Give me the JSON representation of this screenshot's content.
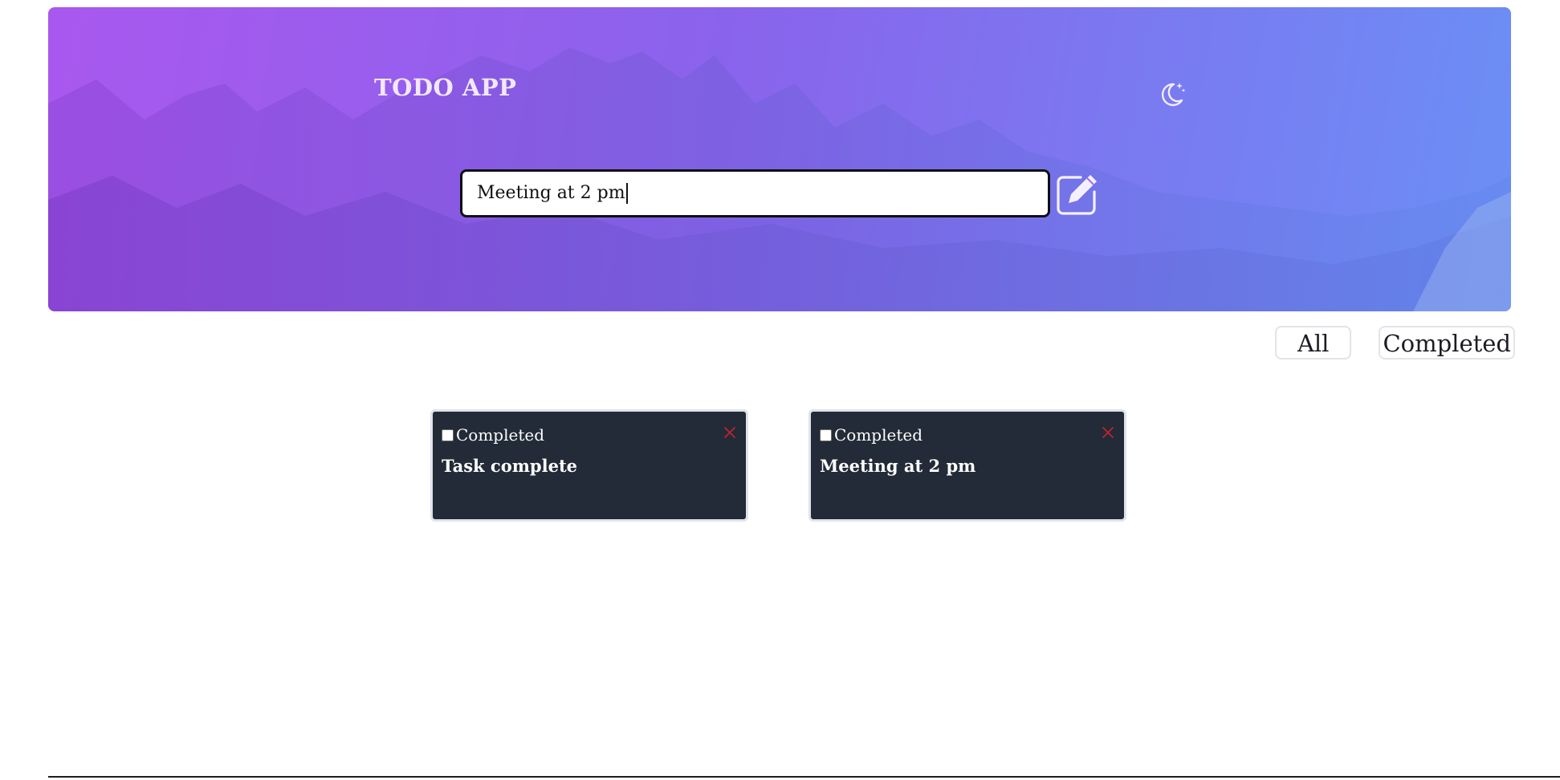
{
  "app": {
    "title": "TODO APP"
  },
  "input": {
    "value": "Meeting at 2 pm"
  },
  "icons": {
    "theme": "moon-stars-icon",
    "add": "edit-square-icon",
    "close": "x-close-icon"
  },
  "filters": [
    {
      "label": "All"
    },
    {
      "label": "Completed"
    }
  ],
  "tasks": [
    {
      "checkbox_label": "Completed",
      "title": "Task complete",
      "checked": false
    },
    {
      "checkbox_label": "Completed",
      "title": "Meeting at 2 pm",
      "checked": false
    }
  ],
  "colors": {
    "banner_start": "#a958ee",
    "banner_end": "#6b8ff5",
    "card_bg": "#222b37",
    "close_icon": "#c0242c"
  }
}
